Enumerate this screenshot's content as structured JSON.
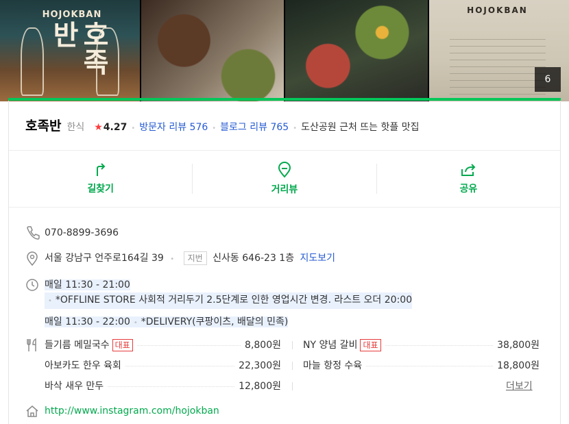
{
  "photos": {
    "logo_word": "HOJOKBAN",
    "logo_han": "호족반",
    "menu_heading": "HOJOKBAN",
    "photo_count": "6"
  },
  "place": {
    "name": "호족반",
    "category": "한식",
    "rating": "4.27",
    "visitor_review": "방문자 리뷰 576",
    "blog_review": "블로그 리뷰 765",
    "description": "도산공원 근처 뜨는 핫플 맛집"
  },
  "actions": [
    {
      "label": "길찾기",
      "icon": "directions-icon"
    },
    {
      "label": "거리뷰",
      "icon": "streetview-icon"
    },
    {
      "label": "공유",
      "icon": "share-icon"
    }
  ],
  "info": {
    "phone": "070-8899-3696",
    "address": "서울 강남구 언주로164길 39",
    "jibun_label": "지번",
    "jibun_address": "신사동 646-23 1층",
    "map_link": "지도보기",
    "hours1": "매일 11:30 - 21:00",
    "hours1_note": "*OFFLINE STORE 사회적 거리두기 2.5단계로 인한 영업시간 변경. 라스트 오더 20:00",
    "hours2": "매일 11:30 - 22:00",
    "hours2_note": "*DELIVERY(쿠팡이츠, 배달의 민족)",
    "website": "http://www.instagram.com/hojokban"
  },
  "menu": {
    "badge": "대표",
    "more": "더보기",
    "items": [
      {
        "name": "들기름 메밀국수",
        "price": "8,800원",
        "rep": true
      },
      {
        "name": "NY 양념 갈비",
        "price": "38,800원",
        "rep": true
      },
      {
        "name": "아보카도 한우 육회",
        "price": "22,300원",
        "rep": false
      },
      {
        "name": "마늘 항정 수육",
        "price": "18,800원",
        "rep": false
      },
      {
        "name": "바삭 새우 만두",
        "price": "12,800원",
        "rep": false
      }
    ]
  },
  "colors": {
    "accent": "#03c75a",
    "link": "#245ad1",
    "star": "#ff3b3b",
    "badge": "#e63b3b"
  }
}
